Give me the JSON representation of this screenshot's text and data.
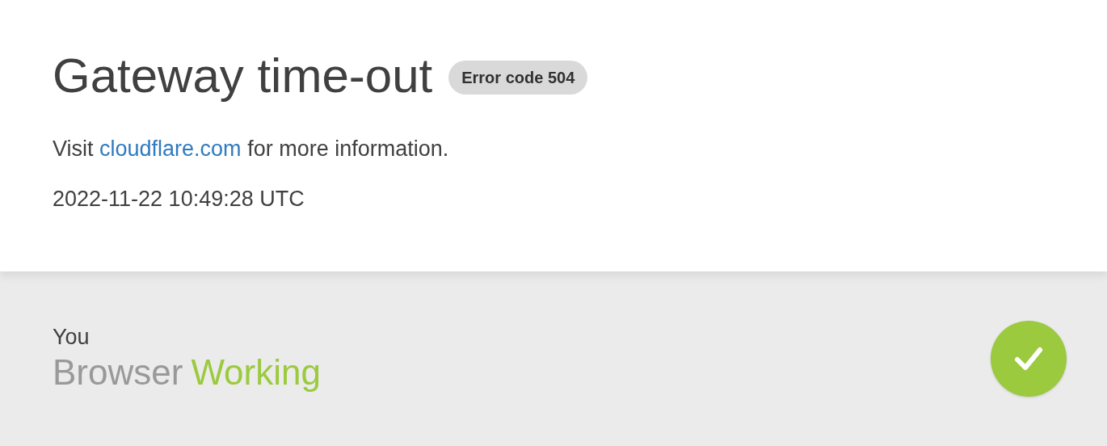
{
  "header": {
    "title": "Gateway time-out",
    "badge": "Error code 504"
  },
  "message": {
    "before": "Visit ",
    "link": "cloudflare.com",
    "after": " for more information."
  },
  "timestamp": "2022-11-22 10:49:28 UTC",
  "status_section": {
    "location": "You",
    "name": "Browser",
    "status": "Working",
    "kind": "ok"
  }
}
